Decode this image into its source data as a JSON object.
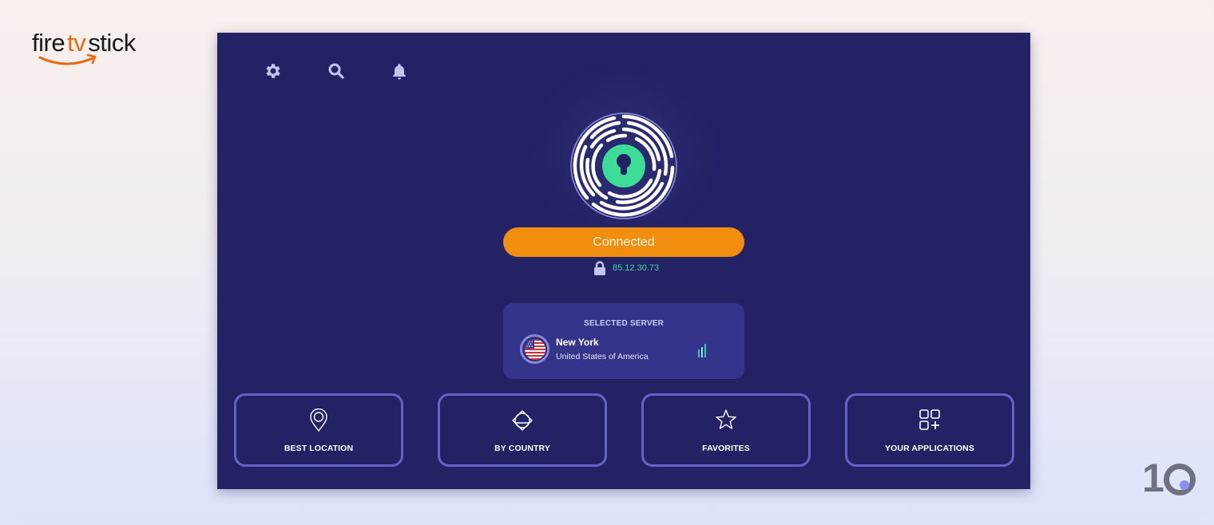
{
  "branding": {
    "logo": {
      "part1": "fire",
      "part2": "tv",
      "part3": "stick"
    },
    "corner_badge": "10",
    "colors": {
      "amazon_orange": "#ea6a12",
      "badge_dot": "#8a8ff0"
    }
  },
  "app": {
    "top_icons": [
      {
        "name": "settings",
        "icon": "gear-icon"
      },
      {
        "name": "search",
        "icon": "search-icon"
      },
      {
        "name": "notifications",
        "icon": "bell-icon"
      }
    ],
    "status": {
      "button_label": "Connected",
      "ip_address": "85.12.30.73",
      "lock_icon": "lock-icon"
    },
    "selected_server": {
      "heading": "SELECTED SERVER",
      "city": "New York",
      "country": "United States of America",
      "flag": "us-flag-icon",
      "signal_icon": "signal-strength-icon"
    },
    "tiles": [
      {
        "label": "BEST LOCATION",
        "icon": "location-pin-icon"
      },
      {
        "label": "BY COUNTRY",
        "icon": "globe-orbit-icon"
      },
      {
        "label": "FAVORITES",
        "icon": "star-icon"
      },
      {
        "label": "YOUR APPLICATIONS",
        "icon": "apps-add-icon"
      }
    ],
    "colors": {
      "background": "#232265",
      "accent_orange": "#f28e0f",
      "ip_green": "#3fd6a4",
      "keyhole_green": "#3ddc97",
      "tile_border": "#6464c8",
      "card_bg": "#34348a"
    }
  }
}
